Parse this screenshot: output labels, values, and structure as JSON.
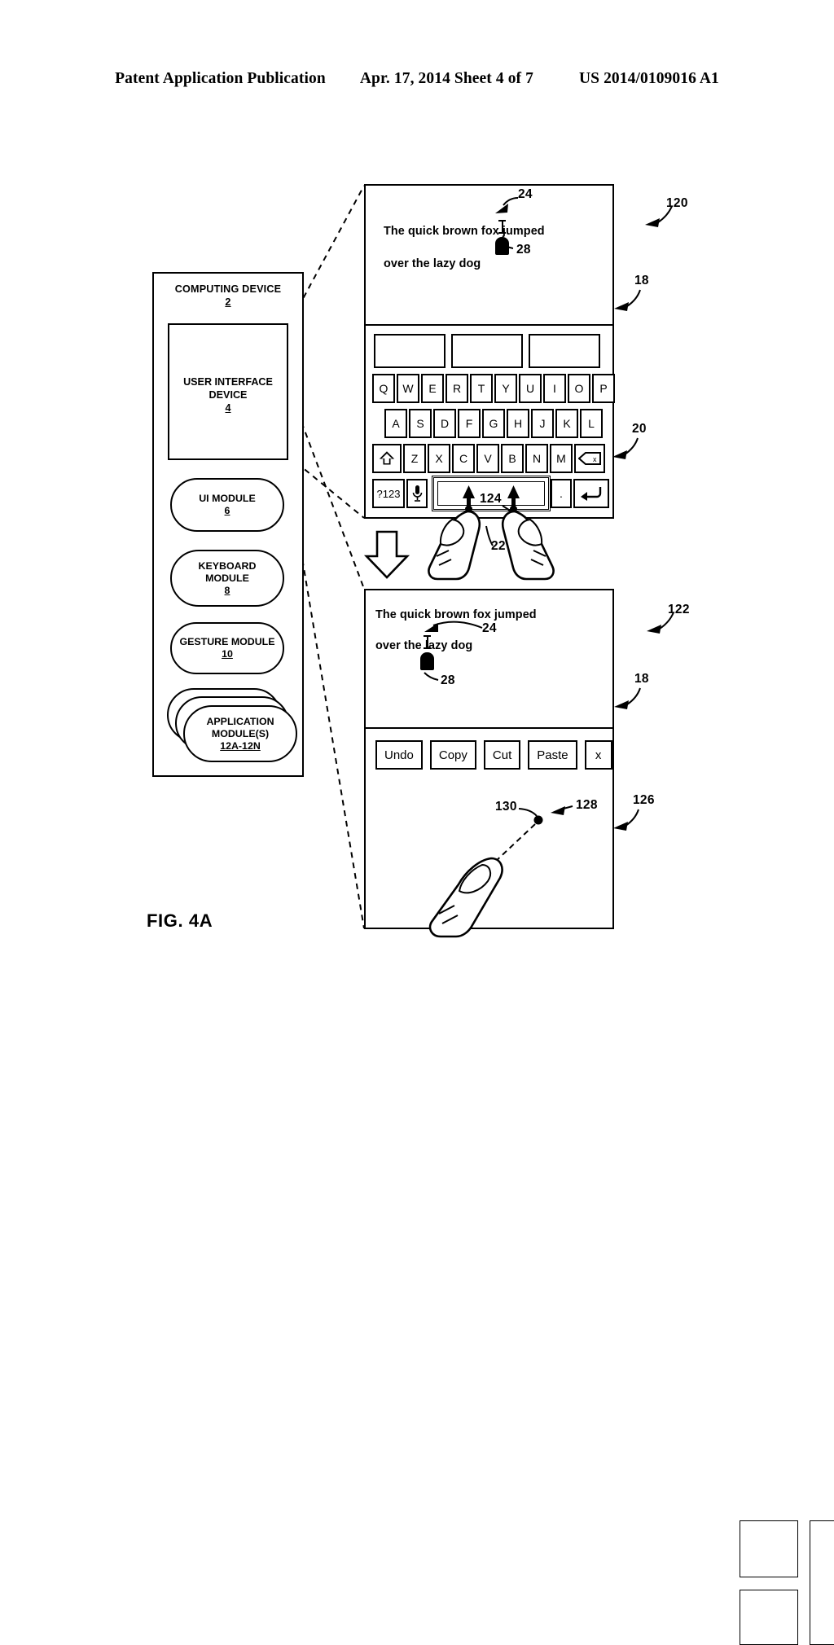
{
  "header": {
    "left": "Patent Application Publication",
    "middle": "Apr. 17, 2014  Sheet 4 of 7",
    "right": "US 2014/0109016 A1"
  },
  "figure": {
    "caption": "FIG. 4A"
  },
  "computing_device": {
    "title": "COMPUTING DEVICE",
    "ref": "2",
    "user_interface_device": {
      "line1": "USER INTERFACE",
      "line2": "DEVICE",
      "ref": "4"
    },
    "modules": [
      {
        "name": "ui-module",
        "line1": "UI MODULE",
        "line2": "",
        "ref": "6"
      },
      {
        "name": "keyboard-module",
        "line1": "KEYBOARD",
        "line2": "MODULE",
        "ref": "8"
      },
      {
        "name": "gesture-module",
        "line1": "GESTURE MODULE",
        "line2": "",
        "ref": "10"
      },
      {
        "name": "application-modules",
        "line1": "APPLICATION",
        "line2": "MODULE(S)",
        "ref": "12A-12N"
      }
    ]
  },
  "device_120": {
    "ref": "120",
    "display_ref": "18",
    "keyboard_ref": "20",
    "text": {
      "line1": "The quick brown fox jumped",
      "line2": "over the lazy dog",
      "cursor_ref": "24",
      "handle_ref": "28"
    },
    "suggestions": [
      "",
      "",
      ""
    ],
    "keyboard": {
      "row1": [
        "Q",
        "W",
        "E",
        "R",
        "T",
        "Y",
        "U",
        "I",
        "O",
        "P"
      ],
      "row2": [
        "A",
        "S",
        "D",
        "F",
        "G",
        "H",
        "J",
        "K",
        "L"
      ],
      "row3": [
        "shift-icon",
        "Z",
        "X",
        "C",
        "V",
        "B",
        "N",
        "M",
        "backspace-icon"
      ],
      "row4": [
        "?123",
        "microphone-icon",
        "space",
        ".",
        "enter-icon"
      ],
      "shift_label": "⇧",
      "symbols_label": "?123",
      "period_label": "."
    },
    "gesture": {
      "fingers_ref": "22",
      "arrows_ref": "124"
    }
  },
  "device_122": {
    "ref": "122",
    "display_ref": "18",
    "menu_ref": "126",
    "text": {
      "line1": "The quick brown fox jumped",
      "line2": "over the lazy dog",
      "cursor_ref": "24",
      "handle_ref": "28"
    },
    "edit_menu": [
      "Undo",
      "Copy",
      "Cut",
      "Paste",
      "x"
    ],
    "gesture_pad": {
      "pad_ref": "128",
      "point_ref": "130",
      "backspace_label": "backspace-icon",
      "enter_label": "enter-icon"
    }
  }
}
